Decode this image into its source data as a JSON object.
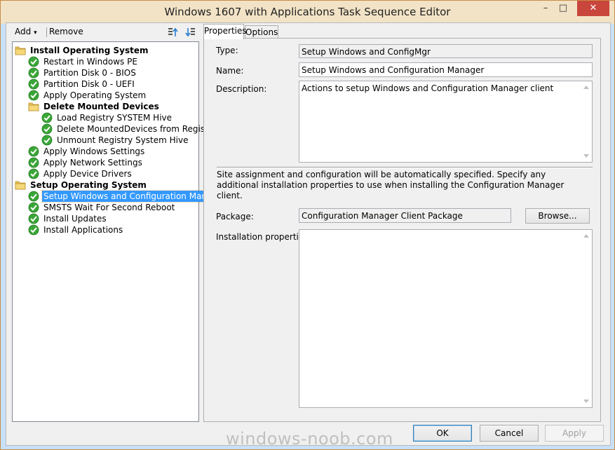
{
  "window": {
    "title": "Windows 1607 with Applications Task Sequence Editor",
    "minimize": "–",
    "maximize": "□",
    "close": "✕"
  },
  "toolbar": {
    "add_label": "Add",
    "add_arrow": "▾",
    "remove_label": "Remove",
    "icons": [
      "move-up-icon",
      "move-down-icon"
    ]
  },
  "tree": {
    "nodes": [
      {
        "label": "Install Operating System",
        "type": "group",
        "icon": "folder-icon"
      },
      {
        "label": "Restart in Windows PE",
        "type": "step",
        "icon": "check-icon"
      },
      {
        "label": "Partition Disk 0 - BIOS",
        "type": "step",
        "icon": "check-icon"
      },
      {
        "label": "Partition Disk 0 - UEFI",
        "type": "step",
        "icon": "check-icon"
      },
      {
        "label": "Apply Operating System",
        "type": "step",
        "icon": "check-icon"
      },
      {
        "label": "Delete Mounted Devices",
        "type": "group",
        "icon": "folder-icon"
      },
      {
        "label": "Load Registry SYSTEM Hive",
        "type": "step",
        "icon": "check-icon"
      },
      {
        "label": "Delete MountedDevices from Registry",
        "type": "step",
        "icon": "check-icon"
      },
      {
        "label": "Unmount Registry System Hive",
        "type": "step",
        "icon": "check-icon"
      },
      {
        "label": "Apply Windows Settings",
        "type": "step",
        "icon": "check-icon"
      },
      {
        "label": "Apply Network Settings",
        "type": "step",
        "icon": "check-icon"
      },
      {
        "label": "Apply Device Drivers",
        "type": "step",
        "icon": "check-icon"
      },
      {
        "label": "Setup Operating System",
        "type": "group",
        "icon": "folder-icon"
      },
      {
        "label": "Setup Windows and Configuration Manager",
        "type": "step",
        "icon": "check-icon",
        "selected": true
      },
      {
        "label": "SMSTS Wait For Second Reboot",
        "type": "step",
        "icon": "check-icon"
      },
      {
        "label": "Install Updates",
        "type": "step",
        "icon": "check-icon"
      },
      {
        "label": "Install Applications",
        "type": "step",
        "icon": "check-icon"
      }
    ]
  },
  "tabs": {
    "properties": "Properties",
    "options": "Options",
    "active": "Properties"
  },
  "properties": {
    "type_label": "Type:",
    "type_value": "Setup Windows and ConfigMgr",
    "name_label": "Name:",
    "name_value": "Setup Windows and Configuration Manager",
    "description_label": "Description:",
    "description_value": "Actions to setup Windows and Configuration Manager client",
    "info_text": "Site assignment and configuration will be automatically specified. Specify any additional installation properties to use when installing the Configuration Manager client.",
    "package_label": "Package:",
    "package_value": "Configuration Manager Client Package",
    "browse_label": "Browse...",
    "install_props_label": "Installation properties:",
    "install_props_value": ""
  },
  "footer": {
    "ok_label": "OK",
    "cancel_label": "Cancel",
    "apply_label": "Apply"
  },
  "watermark": "windows-noob.com",
  "colors": {
    "selection": "#3399ff",
    "check_green": "#3aa637",
    "folder_yellow": "#e8c25a",
    "close_red": "#c9463d",
    "titlebar": "#f2e3c6"
  }
}
